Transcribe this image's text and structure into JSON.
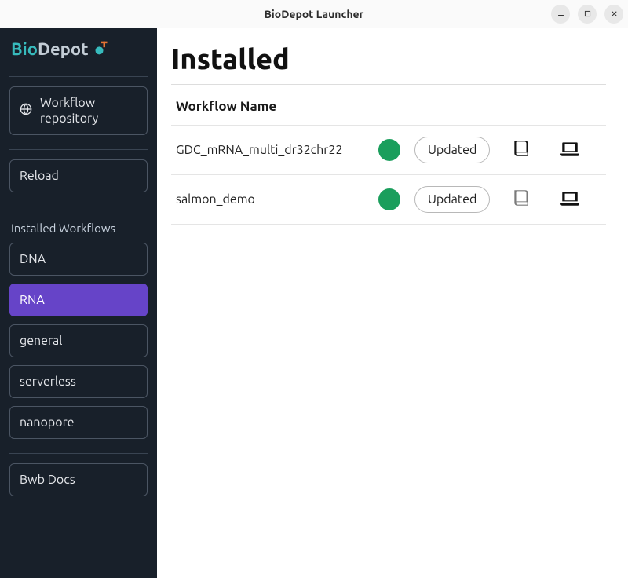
{
  "window": {
    "title": "BioDepot Launcher"
  },
  "brand": {
    "bio": "Bio",
    "depot": "Depot"
  },
  "sidebar": {
    "workflow_repo_label": "Workflow repository",
    "reload_label": "Reload",
    "section_label": "Installed Workflows",
    "categories": {
      "dna": "DNA",
      "rna": "RNA",
      "general": "general",
      "serverless": "serverless",
      "nanopore": "nanopore"
    },
    "bwb_docs_label": "Bwb Docs"
  },
  "main": {
    "title": "Installed",
    "column_header": "Workflow Name",
    "rows": [
      {
        "name": "GDC_mRNA_multi_dr32chr22",
        "status_color": "green",
        "pill": "Updated",
        "book_muted": false
      },
      {
        "name": "salmon_demo",
        "status_color": "green",
        "pill": "Updated",
        "book_muted": true
      }
    ]
  }
}
